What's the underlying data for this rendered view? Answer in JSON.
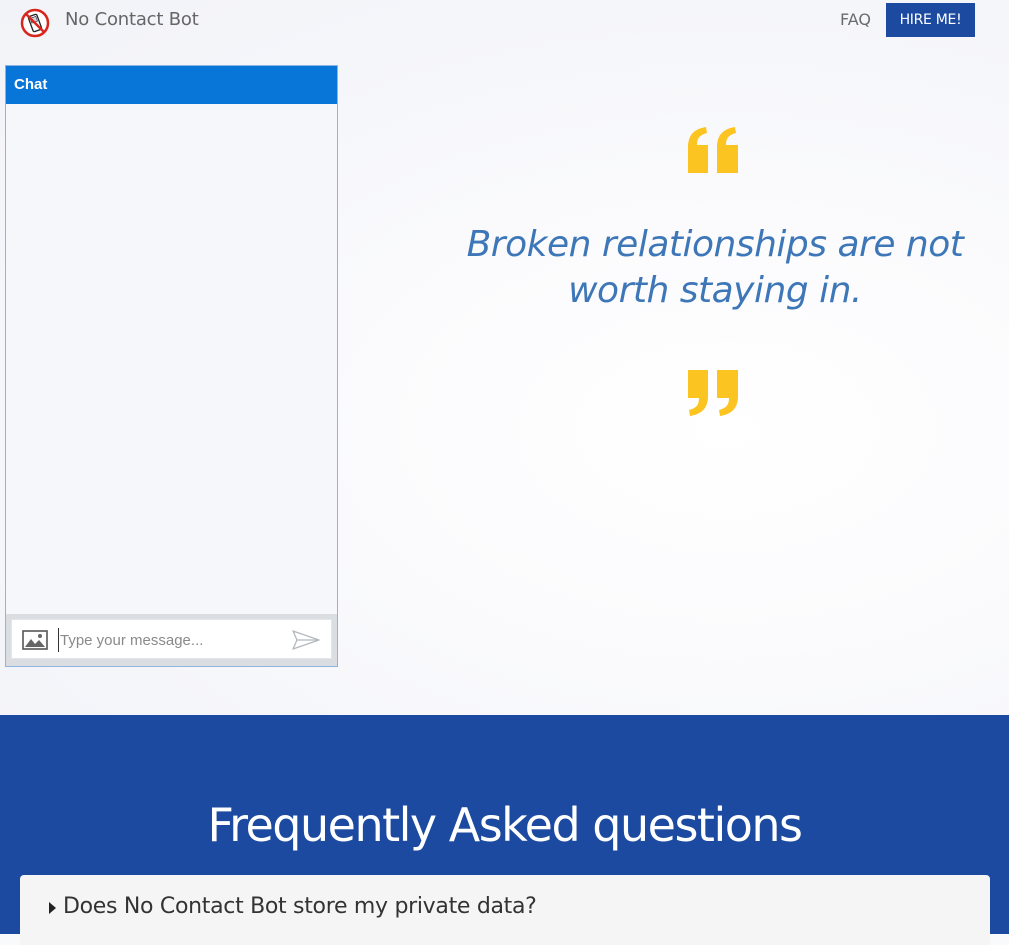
{
  "header": {
    "brand_name": "No Contact Bot",
    "nav_faq": "FAQ",
    "hire_button": "HIRE ME!"
  },
  "chat": {
    "title": "Chat",
    "input_placeholder": "Type your message...",
    "icons": {
      "attach": "image-icon",
      "send": "send-icon"
    }
  },
  "hero": {
    "quote": "Broken relationships are not worth staying in.",
    "quote_color": "#3e77b8",
    "quote_mark_color": "#fcc420"
  },
  "faq": {
    "title": "Frequently Asked questions",
    "items": [
      {
        "question": "Does No Contact Bot store my private data?"
      }
    ]
  },
  "colors": {
    "primary": "#1c4aa0",
    "chat_header": "#0875d8",
    "accent_yellow": "#fcc420"
  }
}
